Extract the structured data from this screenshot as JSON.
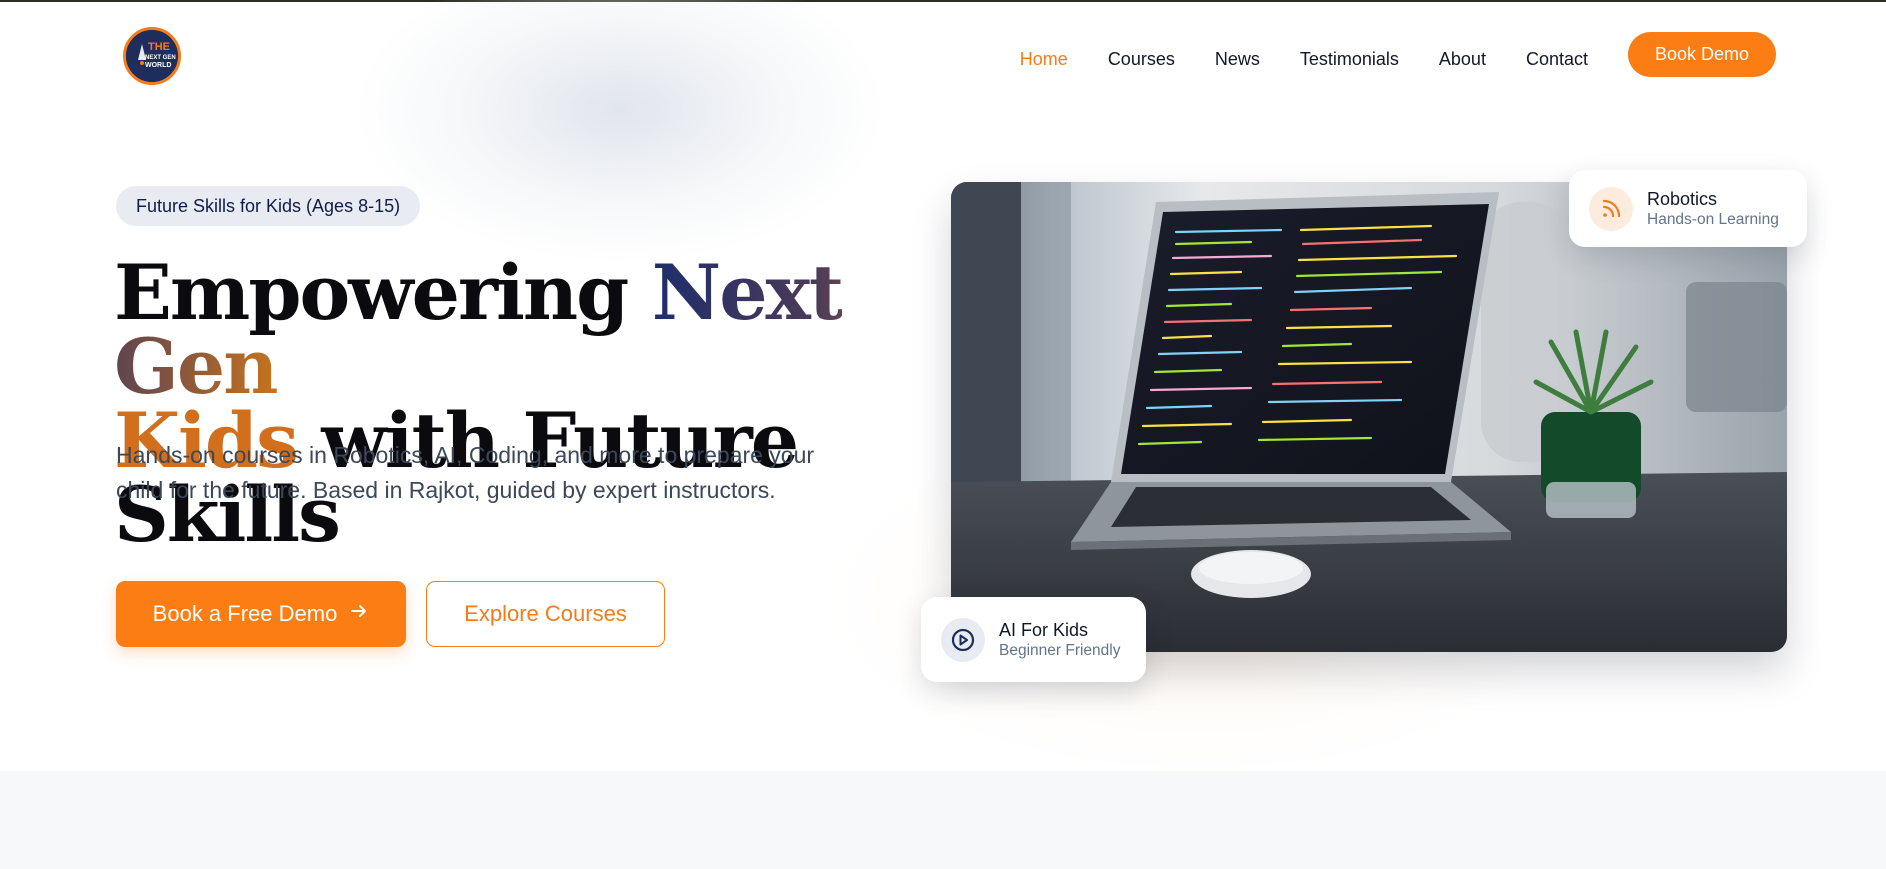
{
  "brand": {
    "logo_text": "THE NEXT GEN WORLD",
    "accent": "#fb7d13",
    "navy": "#1e2d5c"
  },
  "nav": {
    "items": [
      {
        "label": "Home",
        "active": true
      },
      {
        "label": "Courses",
        "active": false
      },
      {
        "label": "News",
        "active": false
      },
      {
        "label": "Testimonials",
        "active": false
      },
      {
        "label": "About",
        "active": false
      },
      {
        "label": "Contact",
        "active": false
      }
    ],
    "cta_label": "Book Demo"
  },
  "hero": {
    "badge": "Future Skills for Kids (Ages 8-15)",
    "headline": {
      "part1": "Empowering ",
      "part2": "Next Gen",
      "part3": "Kids",
      "part4": " with Future Skills"
    },
    "description": "Hands-on courses in Robotics, AI, Coding, and more to prepare your child for the future. Based in Rajkot, guided by expert instructors.",
    "primary_cta": "Book a Free Demo",
    "primary_cta_icon": "arrow-right-icon",
    "secondary_cta": "Explore Courses"
  },
  "cards": {
    "robotics": {
      "title": "Robotics",
      "subtitle": "Hands-on Learning",
      "icon": "rss-icon"
    },
    "ai": {
      "title": "AI For Kids",
      "subtitle": "Beginner Friendly",
      "icon": "play-circle-icon"
    }
  }
}
